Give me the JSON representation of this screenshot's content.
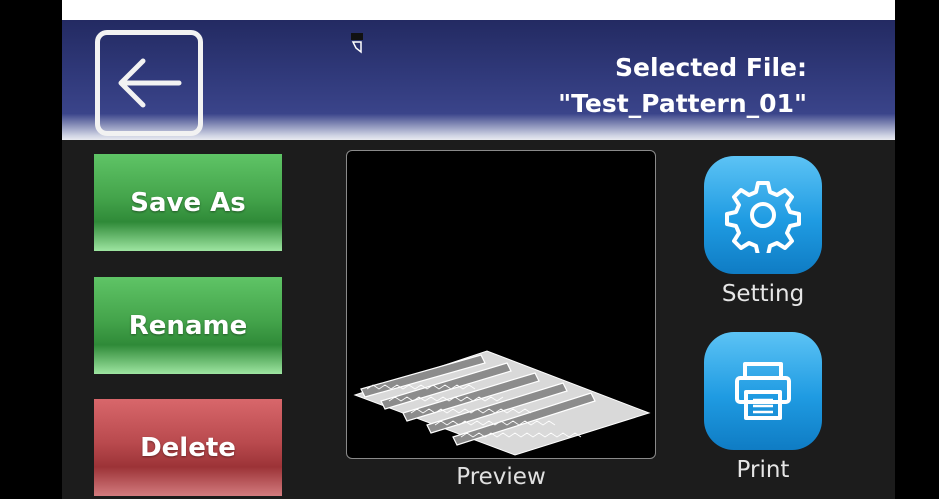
{
  "header": {
    "file_label_line1": "Selected File:",
    "file_label_line2": "\"Test_Pattern_01\"",
    "back_icon": "arrow-left-icon",
    "status_icon": "usb-drive-icon"
  },
  "actions": {
    "save_as": "Save As",
    "rename": "Rename",
    "delete": "Delete"
  },
  "preview": {
    "label": "Preview"
  },
  "side_buttons": {
    "setting_label": "Setting",
    "setting_icon": "gear-icon",
    "print_label": "Print",
    "print_icon": "printer-icon"
  },
  "colors": {
    "header": "#30397a",
    "green_button": "#44a44b",
    "red_button": "#b94a4e",
    "blue_button": "#1f9be2"
  }
}
